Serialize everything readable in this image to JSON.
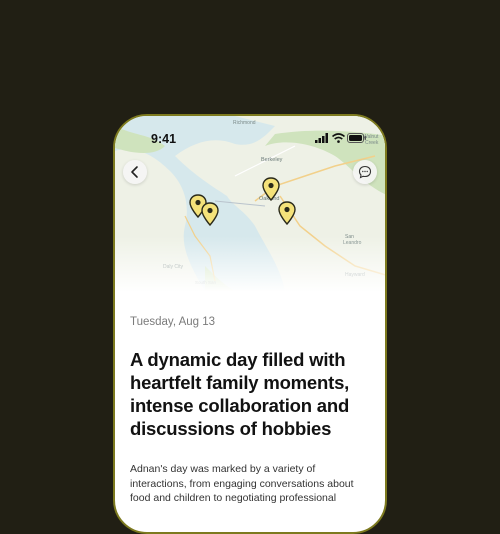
{
  "status_bar": {
    "time": "9:41"
  },
  "map": {
    "pins": [
      {
        "name": "pin-1",
        "label": ""
      },
      {
        "name": "pin-2",
        "label": ""
      },
      {
        "name": "pin-3",
        "label": ""
      },
      {
        "name": "pin-4",
        "label": ""
      }
    ],
    "pin_color": "#f4e27a",
    "places": [
      "Richmond",
      "Walnut Creek",
      "Berkeley",
      "Oakland",
      "San Leandro",
      "Daly City",
      "Hayward",
      "South San Francisco"
    ]
  },
  "buttons": {
    "back_icon": "chevron-left-icon",
    "chat_icon": "chat-bubble-icon"
  },
  "entry": {
    "date": "Tuesday, Aug 13",
    "headline": "A dynamic day filled with heartfelt family moments, intense collaboration and discussions of hobbies",
    "summary": "Adnan's day was marked by a variety of interactions, from engaging conversations about food and children to negotiating professional"
  },
  "colors": {
    "background": "#211f14",
    "frame": "#7d7a1f",
    "water": "#d6e8ec",
    "land": "#eef1e6",
    "park": "#cfe3bd"
  }
}
